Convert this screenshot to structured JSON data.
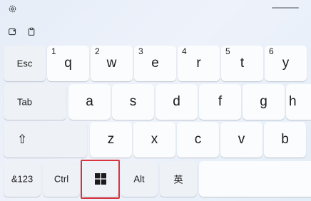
{
  "toolbar": {
    "settings_icon": "gear-icon",
    "sticker_icon": "sticker-icon",
    "clipboard_icon": "clipboard-icon"
  },
  "keyboard": {
    "row1": [
      {
        "id": "esc",
        "label": "Esc"
      },
      {
        "id": "q",
        "label": "q",
        "num": "1"
      },
      {
        "id": "w",
        "label": "w",
        "num": "2"
      },
      {
        "id": "e",
        "label": "e",
        "num": "3"
      },
      {
        "id": "r",
        "label": "r",
        "num": "4"
      },
      {
        "id": "t",
        "label": "t",
        "num": "5"
      },
      {
        "id": "y",
        "label": "y",
        "num": "6"
      }
    ],
    "row2": [
      {
        "id": "tab",
        "label": "Tab"
      },
      {
        "id": "a",
        "label": "a"
      },
      {
        "id": "s",
        "label": "s"
      },
      {
        "id": "d",
        "label": "d"
      },
      {
        "id": "f",
        "label": "f"
      },
      {
        "id": "g",
        "label": "g"
      },
      {
        "id": "h",
        "label": "h"
      }
    ],
    "row3": [
      {
        "id": "shift",
        "label": "⇧"
      },
      {
        "id": "z",
        "label": "z"
      },
      {
        "id": "x",
        "label": "x"
      },
      {
        "id": "c",
        "label": "c"
      },
      {
        "id": "v",
        "label": "v"
      },
      {
        "id": "b",
        "label": "b"
      }
    ],
    "row4": [
      {
        "id": "symbols",
        "label": "&123"
      },
      {
        "id": "ctrl",
        "label": "Ctrl"
      },
      {
        "id": "win",
        "label": "windows-logo-icon"
      },
      {
        "id": "alt",
        "label": "Alt"
      },
      {
        "id": "ime",
        "label": "英"
      },
      {
        "id": "space",
        "label": ""
      }
    ]
  },
  "colors": {
    "highlight_border": "#d9343e",
    "key_bg": "#fbfcfe",
    "panel_bg": "#e9eff8"
  }
}
